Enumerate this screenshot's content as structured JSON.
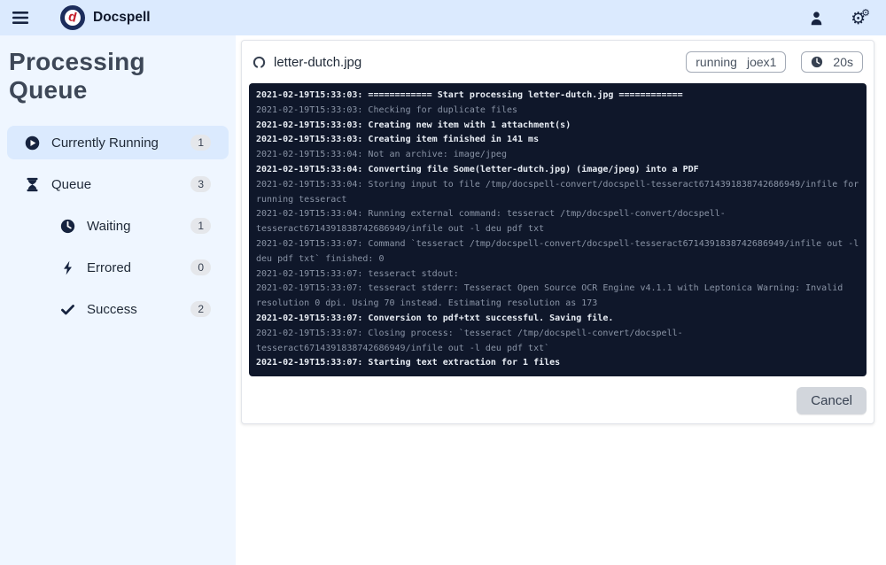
{
  "colors": {
    "topbar_bg": "#dbeafe",
    "sidebar_bg": "#eff6ff",
    "active_item_bg": "#dbeafe",
    "console_bg": "#0f172a",
    "console_text_bold": "#e8edf4",
    "console_text_dim": "#8a94a6",
    "brand_navy": "#16233f",
    "brand_red": "#c41e2a"
  },
  "topbar": {
    "app_name": "Docspell",
    "icons": [
      "menu-icon",
      "user-icon",
      "gears-icon"
    ]
  },
  "sidebar": {
    "title": "Processing Queue",
    "items": [
      {
        "label": "Currently Running",
        "count": "1",
        "icon": "play-circle-icon",
        "active": true,
        "indent": false
      },
      {
        "label": "Queue",
        "count": "3",
        "icon": "hourglass-icon",
        "active": false,
        "indent": false
      },
      {
        "label": "Waiting",
        "count": "1",
        "icon": "clock-icon",
        "active": false,
        "indent": true
      },
      {
        "label": "Errored",
        "count": "0",
        "icon": "bolt-icon",
        "active": false,
        "indent": true
      },
      {
        "label": "Success",
        "count": "2",
        "icon": "check-icon",
        "active": false,
        "indent": true
      }
    ]
  },
  "job_card": {
    "title": "letter-dutch.jpg",
    "title_icon": "spinner-icon",
    "state_badge": {
      "state": "running",
      "worker": "joex1"
    },
    "duration_badge": {
      "icon": "clock-icon",
      "value": "20s"
    },
    "cancel_label": "Cancel",
    "log_lines": [
      {
        "time": "2021-02-19T15:33:03:",
        "msg": "============ Start processing letter-dutch.jpg ============",
        "bold": true
      },
      {
        "time": "2021-02-19T15:33:03:",
        "msg": "Checking for duplicate files",
        "bold": false
      },
      {
        "time": "2021-02-19T15:33:03:",
        "msg": "Creating new item with 1 attachment(s)",
        "bold": true
      },
      {
        "time": "2021-02-19T15:33:03:",
        "msg": "Creating item finished in 141 ms",
        "bold": true
      },
      {
        "time": "2021-02-19T15:33:04:",
        "msg": "Not an archive: image/jpeg",
        "bold": false
      },
      {
        "time": "2021-02-19T15:33:04:",
        "msg": "Converting file Some(letter-dutch.jpg) (image/jpeg) into a PDF",
        "bold": true
      },
      {
        "time": "2021-02-19T15:33:04:",
        "msg": "Storing input to file /tmp/docspell-convert/docspell-tesseract6714391838742686949/infile for running tesseract",
        "bold": false
      },
      {
        "time": "2021-02-19T15:33:04:",
        "msg": "Running external command: tesseract /tmp/docspell-convert/docspell-tesseract6714391838742686949/infile out -l deu pdf txt",
        "bold": false
      },
      {
        "time": "2021-02-19T15:33:07:",
        "msg": "Command `tesseract /tmp/docspell-convert/docspell-tesseract6714391838742686949/infile out -l deu pdf txt` finished: 0",
        "bold": false
      },
      {
        "time": "2021-02-19T15:33:07:",
        "msg": "tesseract stdout:",
        "bold": false
      },
      {
        "time": "2021-02-19T15:33:07:",
        "msg": "tesseract stderr: Tesseract Open Source OCR Engine v4.1.1 with Leptonica Warning: Invalid resolution 0 dpi. Using 70 instead. Estimating resolution as 173",
        "bold": false
      },
      {
        "time": "2021-02-19T15:33:07:",
        "msg": "Conversion to pdf+txt successful. Saving file.",
        "bold": true
      },
      {
        "time": "2021-02-19T15:33:07:",
        "msg": "Closing process: `tesseract /tmp/docspell-convert/docspell-tesseract6714391838742686949/infile out -l deu pdf txt`",
        "bold": false
      },
      {
        "time": "2021-02-19T15:33:07:",
        "msg": "Starting text extraction for 1 files",
        "bold": true
      }
    ]
  }
}
